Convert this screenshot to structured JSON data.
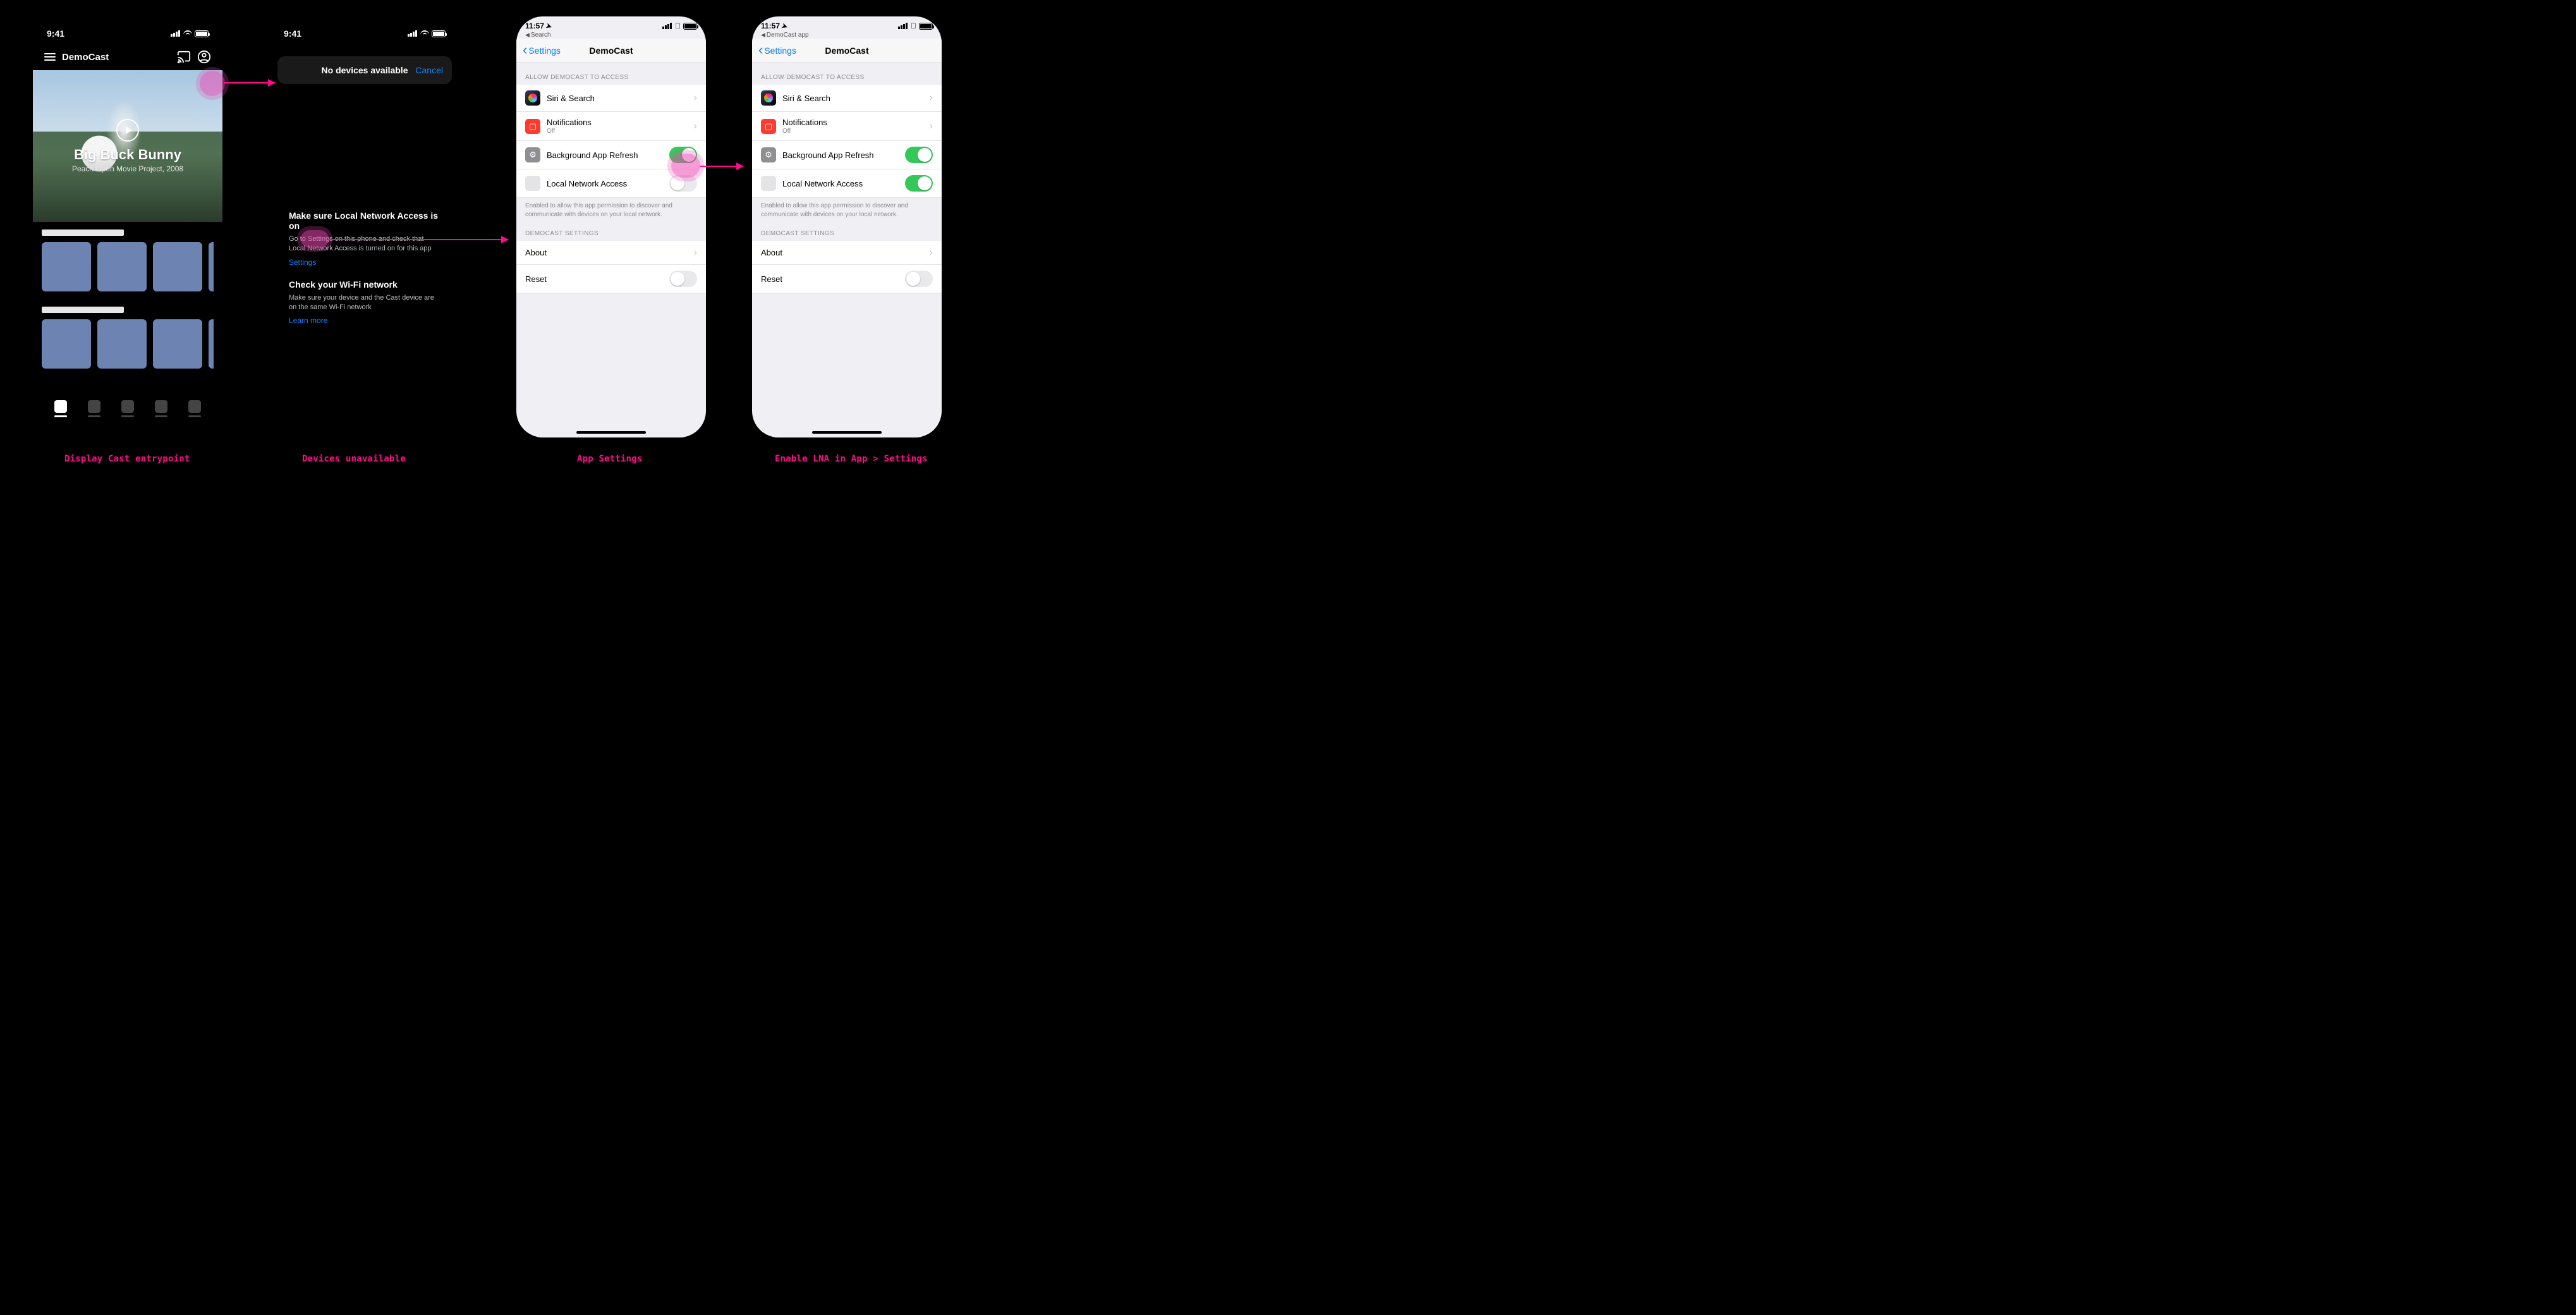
{
  "captions": {
    "p1": "Display Cast entrypoint",
    "p2": "Devices unavailable",
    "p3": "App Settings",
    "p4": "Enable LNA in App > Settings"
  },
  "phone1": {
    "status_time": "9:41",
    "app_name": "DemoCast",
    "hero_title": "Big Buck Bunny",
    "hero_sub": "Peach Open Movie Project, 2008"
  },
  "phone2": {
    "status_time": "9:41",
    "sheet_title": "No devices available",
    "cancel": "Cancel",
    "h1": "Make sure Local Network Access is on",
    "p1": "Go to Settings on this phone and check that Local Network Access is turned on for this app",
    "link1": "Settings",
    "h2": "Check your Wi-Fi network",
    "p2": "Make sure your device and the Cast device are on the same Wi-Fi network",
    "link2": "Learn more"
  },
  "settings_common": {
    "status_time": "11:57",
    "back_label": "Settings",
    "title": "DemoCast",
    "group_access": "Allow DemoCast to Access",
    "row_siri": "Siri & Search",
    "row_notif": "Notifications",
    "row_notif_sub": "Off",
    "row_refresh": "Background App Refresh",
    "row_lna": "Local Network Access",
    "lna_note": "Enabled to allow this app permission to discover and communicate with devices on your local network.",
    "group_app": "DemoCast Settings",
    "row_about": "About",
    "row_reset": "Reset"
  },
  "phone3": {
    "backline": "Search"
  },
  "phone4": {
    "backline": "DemoCast app"
  }
}
